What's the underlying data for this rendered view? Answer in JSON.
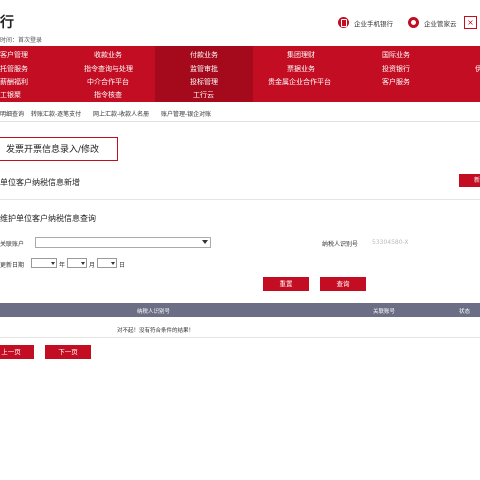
{
  "header": {
    "bank_name": "行",
    "last_login": "时间：首次登录",
    "mobile_bank": "企业手机银行",
    "butler": "企业管家云",
    "close": "×"
  },
  "menu": {
    "row1": [
      "客户管理",
      "收款业务",
      "付款业务",
      "集团理财",
      "国际业务"
    ],
    "row2": [
      "托管服务",
      "指令查询与处理",
      "监管审批",
      "票据业务",
      "投资银行"
    ],
    "row3": [
      "薪酬福利",
      "中介合作平台",
      "投标管理",
      "贵金属企业合作平台",
      "客户服务"
    ],
    "row4": [
      "工银聚",
      "指令核查",
      "工行云"
    ]
  },
  "subnav": [
    "明细查询",
    "转账汇款-逐笔支付",
    "网上汇款-收款人名册",
    "账户管理-银企对账"
  ],
  "title": "发票开票信息录入/修改",
  "section_new": {
    "label": "单位客户纳税信息新增",
    "button": "新"
  },
  "section_query": {
    "label": "维护单位客户纳税信息查询",
    "account_label": "关联账户",
    "tax_label": "纳税人识别号",
    "tax_placeholder": "53304580-X",
    "date_label": "更新日期",
    "year": "年",
    "month": "月",
    "day": "日"
  },
  "buttons": {
    "reset": "重置",
    "query": "查询",
    "prev": "上一页",
    "next": "下一页"
  },
  "table": {
    "columns": [
      "纳税人识别号",
      "关联账号",
      "状态"
    ],
    "empty_message": "对不起！没有符合条件的结果！"
  },
  "colors": {
    "brand": "#c30d23",
    "table_header": "#6b6e84"
  }
}
